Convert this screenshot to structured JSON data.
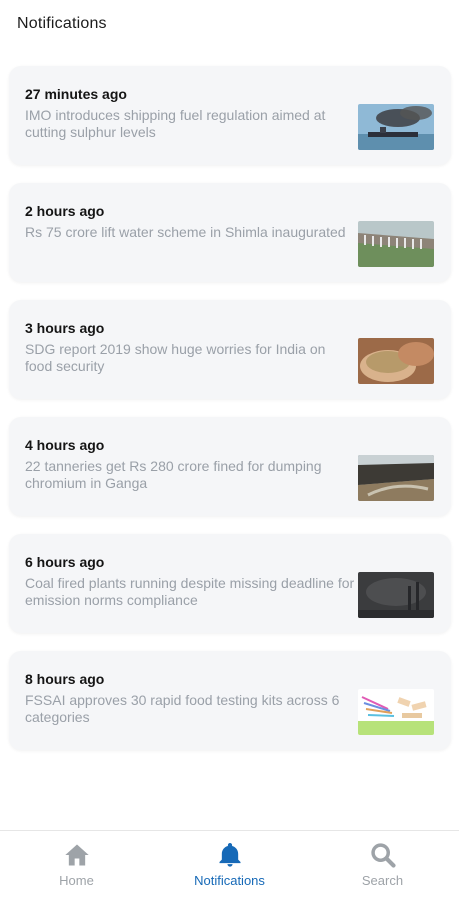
{
  "header": {
    "title": "Notifications"
  },
  "notifications": [
    {
      "time": "27 minutes ago",
      "title": "IMO introduces shipping fuel regulation aimed at cutting sulphur levels"
    },
    {
      "time": "2 hours ago",
      "title": "Rs 75 crore lift water scheme in Shimla inaugurated"
    },
    {
      "time": "3 hours ago",
      "title": "SDG report 2019 show huge worries for India on food security"
    },
    {
      "time": "4 hours ago",
      "title": "22 tanneries get Rs 280 crore fined for dumping chromium in Ganga"
    },
    {
      "time": "6 hours ago",
      "title": "Coal fired plants running despite missing deadline for emission norms compliance"
    },
    {
      "time": "8 hours ago",
      "title": "FSSAI approves 30 rapid food testing kits across 6 categories"
    }
  ],
  "bottom_nav": {
    "home_label": "Home",
    "notifications_label": "Notifications",
    "search_label": "Search"
  },
  "colors": {
    "accent": "#1669b7",
    "inactive": "#9ea3a8",
    "card_bg": "#f5f6f8"
  },
  "icons": {
    "home": "home-icon",
    "notifications": "bell-icon",
    "search": "search-icon"
  }
}
